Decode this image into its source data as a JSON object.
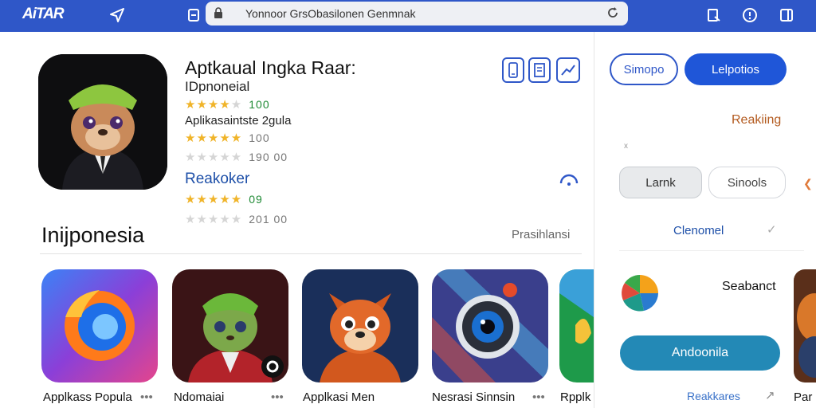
{
  "topbar": {
    "logo": "AiTAR",
    "url": "Yonnoor GrsObasilonen Genmnak",
    "brand_color": "#2f57c8"
  },
  "app": {
    "title": "Aptkaual Ingka Raar:",
    "subtitle": "IDpnoneial",
    "rating1_value": "100",
    "subtitle2": "Aplikasaintste 2gula",
    "rating2_value": "100",
    "rating3_value": "190 00",
    "subtitle3": "Reakoker",
    "rating4_value": "09",
    "rating5_value": "201 00"
  },
  "section": {
    "title": "Inijponesia",
    "link": "Prasihlansi"
  },
  "tiles": [
    {
      "label": "Applkass Popula",
      "icon": "firefox-like-icon"
    },
    {
      "label": "Ndomaiai",
      "icon": "cartoon-character-icon"
    },
    {
      "label": "Applkasi Men",
      "icon": "fox-character-icon"
    },
    {
      "label": "Nesrasi Sinnsin",
      "icon": "camera-lens-icon"
    },
    {
      "label": "Rpplk",
      "icon": "green-app-icon"
    }
  ],
  "right_panel": {
    "pill_outline": "Simopo",
    "pill_solid": "Lelpotios",
    "ranking": "Reakiing",
    "x_mark": "x",
    "pill_grey": "Larnk",
    "pill_light": "Sinools",
    "channel": "Clenomel",
    "search_label": "Seabanct",
    "teal_button": "Andoonila",
    "rek_link": "Reakkares",
    "thumb_label": "Par"
  }
}
